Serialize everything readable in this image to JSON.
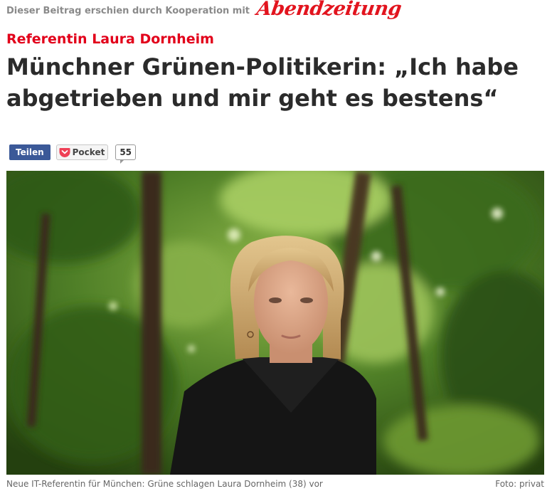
{
  "cooperation": {
    "text": "Dieser Beitrag erschien durch Kooperation mit",
    "partner_logo": "Abendzeitung"
  },
  "article": {
    "kicker": "Referentin Laura Dornheim",
    "headline": "Münchner Grünen-Politikerin: „Ich habe abgetrieben und mir geht es bestens“"
  },
  "share_bar": {
    "share_label": "Teilen",
    "pocket_label": "Pocket",
    "comment_count": "55"
  },
  "photo": {
    "caption": "Neue IT-Referentin für München: Grüne schlagen Laura Dornheim (38) vor",
    "credit": "Foto: privat"
  },
  "colors": {
    "kicker": "#e2001a",
    "logo": "#e2141e",
    "share_button": "#3b5998",
    "pocket_icon": "#ef4056",
    "headline": "#2b2b2b"
  }
}
